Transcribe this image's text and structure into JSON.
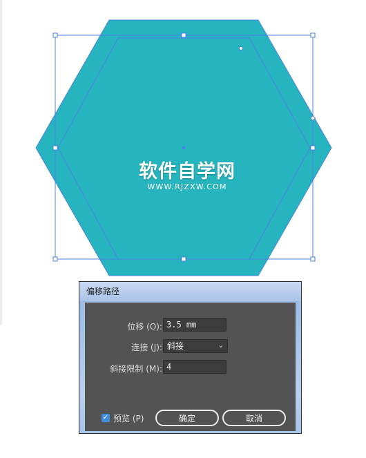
{
  "watermark": {
    "main": "软件自学网",
    "sub": "WWW.RJZXW.COM"
  },
  "colors": {
    "shape_fill": "#26B4BE",
    "selection": "#4A82E6"
  },
  "dialog": {
    "title": "偏移路径",
    "offset": {
      "label": "位移 (O):",
      "value": "3.5 mm"
    },
    "joins": {
      "label": "连接 (J):",
      "value": "斜接",
      "chevron": "⌄"
    },
    "miter_limit": {
      "label": "斜接限制 (M):",
      "value": "4"
    },
    "preview": {
      "label": "预览 (P)",
      "checked": true,
      "check_glyph": "✓"
    },
    "ok_label": "确定",
    "cancel_label": "取消"
  }
}
